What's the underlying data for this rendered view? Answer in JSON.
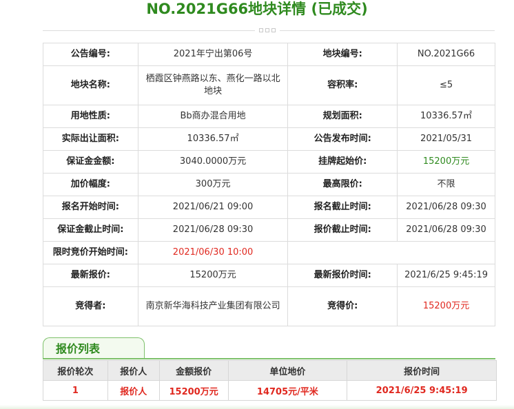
{
  "title": "NO.2021G66地块详情 (已成交)",
  "details": {
    "r1": {
      "k1": "公告编号:",
      "v1": "2021年宁出第06号",
      "k2": "地块编号:",
      "v2": "NO.2021G66"
    },
    "r2": {
      "k1": "地块名称:",
      "v1": "栖霞区钟燕路以东、燕化一路以北地块",
      "k2": "容积率:",
      "v2": "≤5"
    },
    "r3": {
      "k1": "用地性质:",
      "v1": "Bb商办混合用地",
      "k2": "规划面积:",
      "v2": "10336.57㎡"
    },
    "r4": {
      "k1": "实际出让面积:",
      "v1": "10336.57㎡",
      "k2": "公告发布时间:",
      "v2": "2021/05/31"
    },
    "r5": {
      "k1": "保证金金额:",
      "v1": "3040.0000万元",
      "k2": "挂牌起始价:",
      "v2": "15200万元"
    },
    "r6": {
      "k1": "加价幅度:",
      "v1": "300万元",
      "k2": "最高限价:",
      "v2": "不限"
    },
    "r7": {
      "k1": "报名开始时间:",
      "v1": "2021/06/21 09:00",
      "k2": "报名截止时间:",
      "v2": "2021/06/28 09:30"
    },
    "r8": {
      "k1": "保证金截止时间:",
      "v1": "2021/06/28 09:30",
      "k2": "报价截止时间:",
      "v2": "2021/06/28 09:30"
    },
    "r9": {
      "k1": "限时竞价开始时间:",
      "v1": "2021/06/30 10:00"
    },
    "r10": {
      "k1": "最新报价:",
      "v1": "15200万元",
      "k2": "最新报价时间:",
      "v2": "2021/6/25 9:45:19"
    },
    "r11": {
      "k1": "竞得者:",
      "v1": "南京新华海科技产业集团有限公司",
      "k2": "竞得价:",
      "v2": "15200万元"
    }
  },
  "bid_list": {
    "tab_label": "报价列表",
    "headers": [
      "报价轮次",
      "报价人",
      "金额报价",
      "单位地价",
      "报价时间"
    ],
    "rows": [
      [
        "1",
        "报价人",
        "15200万元",
        "14705元/平米",
        "2021/6/25 9:45:19"
      ]
    ]
  },
  "colors": {
    "green": "#2f8a1f",
    "red": "#e0281f",
    "border": "#dcdcdc"
  }
}
